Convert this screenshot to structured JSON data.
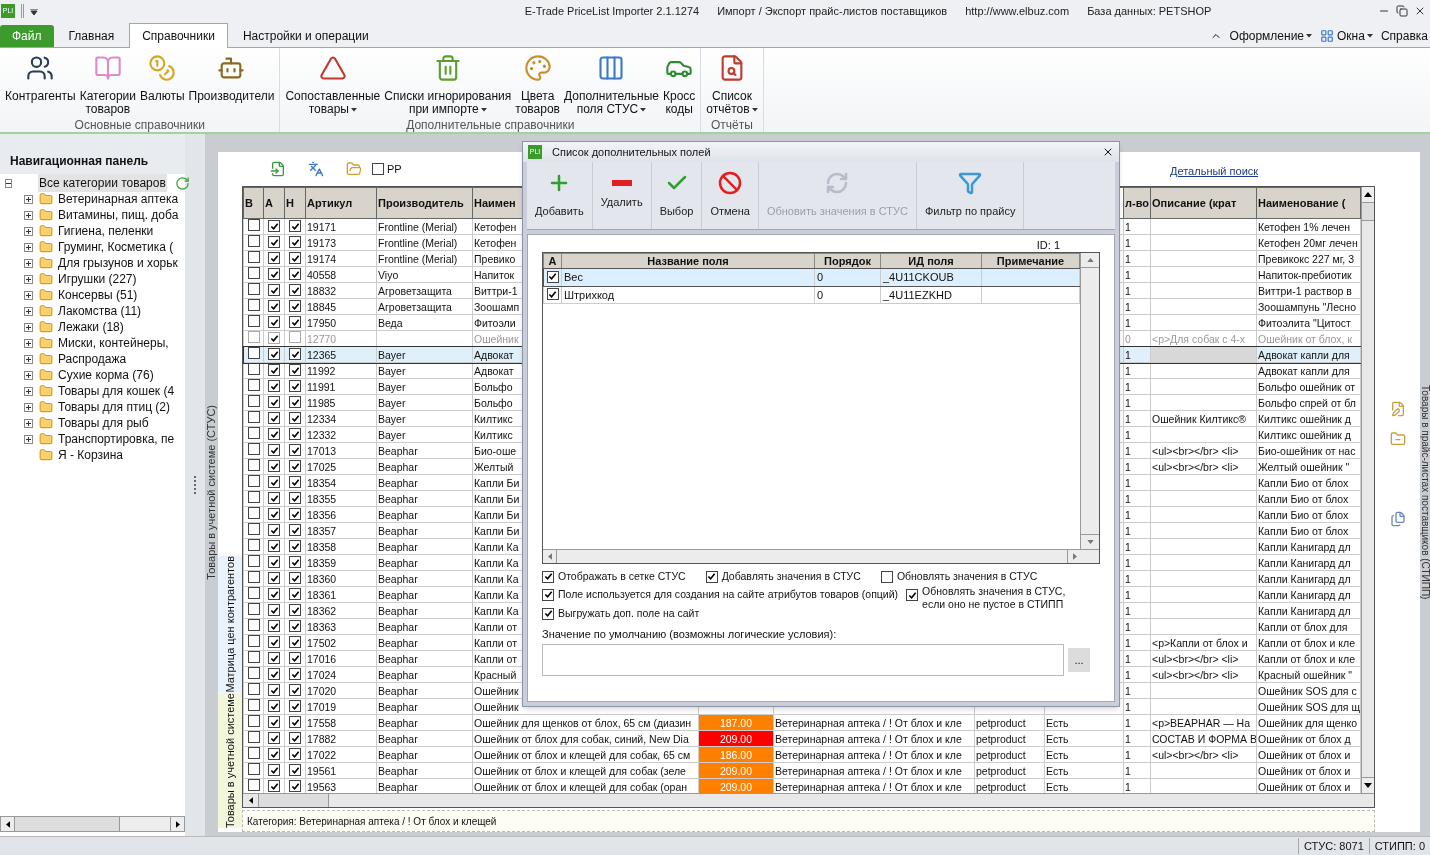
{
  "title_bar": {
    "logo": "PLI",
    "app": "E-Trade PriceList Importer 2.1.1274",
    "subtitle": "Импорт / Экспорт прайс-листов поставщиков",
    "site": "http://www.elbuz.com",
    "database": "База данных: PETSHOP"
  },
  "ribbon_tabs": [
    {
      "label": "Файл",
      "kind": "file",
      "selected": false
    },
    {
      "label": "Главная",
      "kind": "tab",
      "selected": false
    },
    {
      "label": "Справочники",
      "kind": "tab",
      "selected": true
    },
    {
      "label": "Настройки и операции",
      "kind": "tab",
      "selected": false
    }
  ],
  "ribbon_right": [
    {
      "label": "Оформление",
      "dropdown": true
    },
    {
      "label": "Окна",
      "dropdown": true
    },
    {
      "label": "Справка",
      "dropdown": false
    }
  ],
  "ribbon_groups": [
    {
      "title": "Основные справочники",
      "buttons": [
        {
          "label": "Контрагенты",
          "dropdown": false
        },
        {
          "label": "Категории\nтоваров",
          "dropdown": false
        },
        {
          "label": "Валюты",
          "dropdown": false
        },
        {
          "label": "Производители",
          "dropdown": false
        }
      ]
    },
    {
      "title": "Дополнительные справочники",
      "buttons": [
        {
          "label": "Сопоставленные\nтовары",
          "dropdown": true
        },
        {
          "label": "Списки игнорирования\nпри импорте",
          "dropdown": true
        },
        {
          "label": "Цвета\nтоваров",
          "dropdown": false
        },
        {
          "label": "Дополнительные\nполя СТУС",
          "dropdown": true
        },
        {
          "label": "Кросс\nкоды",
          "dropdown": false
        }
      ]
    },
    {
      "title": "Отчёты",
      "buttons": [
        {
          "label": "Список\nотчётов",
          "dropdown": true
        }
      ]
    }
  ],
  "nav_panel": {
    "title": "Навигационная панель",
    "tree": {
      "label": "Все категории товаров",
      "expanded": true,
      "selected": true,
      "children": [
        {
          "label": "Ветеринарная аптека",
          "expandable": true,
          "selected": false
        },
        {
          "label": "Витамины, пищ. доба",
          "expandable": true,
          "selected": false
        },
        {
          "label": "Гигиена, пеленки",
          "expandable": true,
          "selected": false
        },
        {
          "label": "Груминг, Косметика (",
          "expandable": true,
          "selected": false
        },
        {
          "label": "Для грызунов и хорьк",
          "expandable": true,
          "selected": false
        },
        {
          "label": "Игрушки (227)",
          "expandable": true,
          "selected": false
        },
        {
          "label": "Консервы (51)",
          "expandable": true,
          "selected": false
        },
        {
          "label": "Лакомства (11)",
          "expandable": true,
          "selected": false
        },
        {
          "label": "Лежаки (18)",
          "expandable": true,
          "selected": false
        },
        {
          "label": "Миски, контейнеры,",
          "expandable": true,
          "selected": false
        },
        {
          "label": "Распродажа",
          "expandable": true,
          "selected": false
        },
        {
          "label": "Сухие корма (76)",
          "expandable": true,
          "selected": false
        },
        {
          "label": "Товары для кошек (4",
          "expandable": true,
          "selected": false
        },
        {
          "label": "Товары для птиц (2)",
          "expandable": true,
          "selected": false
        },
        {
          "label": "Товары для рыб",
          "expandable": true,
          "selected": false
        },
        {
          "label": "Транспортировка, пе",
          "expandable": true,
          "selected": false
        },
        {
          "label": "Я - Корзина",
          "expandable": false,
          "selected": false
        }
      ]
    }
  },
  "side_tabs": [
    {
      "label": "Товары в учетной системе (СТУС)",
      "selected": false
    },
    {
      "label": "Матрица цен контрагентов",
      "selected": false
    },
    {
      "label": "Товары в учетной системе",
      "selected": true
    }
  ],
  "right_side_tab": "Товары в прайс-листах поставщиков (СТИПП)",
  "grid_toolbar": {
    "checkbox": {
      "label": "PP",
      "checked": false
    },
    "detail_search": "Детальный поиск"
  },
  "grid": {
    "columns": [
      "В",
      "А",
      "Н",
      "Артикул",
      "Производитель",
      "Наимен",
      "",
      "",
      "",
      "",
      "л-во",
      "Описание (крат",
      "Наименование ("
    ],
    "rows": [
      {
        "b": false,
        "a": true,
        "h": true,
        "dimmed": false,
        "selected": false,
        "article": "19171",
        "maker": "Frontline (Merial)",
        "name": "Кетофен",
        "qty": "1",
        "desc": "",
        "name2": "Кетофен 1% лечен"
      },
      {
        "b": false,
        "a": true,
        "h": true,
        "dimmed": false,
        "selected": false,
        "article": "19173",
        "maker": "Frontline (Merial)",
        "name": "Кетофен",
        "qty": "1",
        "desc": "",
        "name2": "Кетофен 20мг лечен"
      },
      {
        "b": false,
        "a": true,
        "h": true,
        "dimmed": false,
        "selected": false,
        "article": "19174",
        "maker": "Frontline (Merial)",
        "name": "Превико",
        "qty": "1",
        "desc": "",
        "name2": "Превикокс 227 мг, 3"
      },
      {
        "b": false,
        "a": true,
        "h": true,
        "dimmed": false,
        "selected": false,
        "article": "40558",
        "maker": "Viyo",
        "name": "Напиток",
        "qty": "1",
        "desc": "",
        "name2": "Напиток-пребиотик"
      },
      {
        "b": false,
        "a": true,
        "h": true,
        "dimmed": false,
        "selected": false,
        "article": "18832",
        "maker": "Агроветзащита",
        "name": "Виттри-1",
        "qty": "1",
        "desc": "",
        "name2": "Виттри-1 раствор в"
      },
      {
        "b": false,
        "a": true,
        "h": true,
        "dimmed": false,
        "selected": false,
        "article": "18845",
        "maker": "Агроветзащита",
        "name": "Зоошамп",
        "qty": "1",
        "desc": "",
        "name2": "Зоошампунь \"Лесно"
      },
      {
        "b": false,
        "a": true,
        "h": true,
        "dimmed": false,
        "selected": false,
        "article": "17950",
        "maker": "Веда",
        "name": "Фитоэли",
        "qty": "1",
        "desc": "",
        "name2": "Фитоэлита \"Цитост"
      },
      {
        "b": false,
        "a": true,
        "h": false,
        "dimmed": true,
        "selected": false,
        "article": "12770",
        "maker": "",
        "name": "Ошейник",
        "qty": "0",
        "desc": "<p>Для собак с 4-х",
        "name2": "Ошейник от блох, к"
      },
      {
        "b": false,
        "a": true,
        "h": true,
        "dimmed": false,
        "selected": true,
        "article": "12365",
        "maker": "Bayer",
        "name": "Адвокат",
        "qty": "1",
        "desc": "",
        "name2": "Адвокат капли для"
      },
      {
        "b": false,
        "a": true,
        "h": true,
        "dimmed": false,
        "selected": false,
        "article": "11992",
        "maker": "Bayer",
        "name": "Адвокат",
        "qty": "1",
        "desc": "",
        "name2": "Адвокат капли для"
      },
      {
        "b": false,
        "a": true,
        "h": true,
        "dimmed": false,
        "selected": false,
        "article": "11991",
        "maker": "Bayer",
        "name": "Больфо",
        "qty": "1",
        "desc": "",
        "name2": "Больфо ошейник от"
      },
      {
        "b": false,
        "a": true,
        "h": true,
        "dimmed": false,
        "selected": false,
        "article": "11985",
        "maker": "Bayer",
        "name": "Больфо",
        "qty": "1",
        "desc": "",
        "name2": "Больфо спрей от бл"
      },
      {
        "b": false,
        "a": true,
        "h": true,
        "dimmed": false,
        "selected": false,
        "article": "12334",
        "maker": "Bayer",
        "name": "Килтикс",
        "qty": "1",
        "desc": "Ошейник Килтикс®",
        "name2": "Килтикс ошейник д"
      },
      {
        "b": false,
        "a": true,
        "h": true,
        "dimmed": false,
        "selected": false,
        "article": "12332",
        "maker": "Bayer",
        "name": "Килтикс",
        "qty": "1",
        "desc": "",
        "name2": "Килтикс ошейник д"
      },
      {
        "b": false,
        "a": true,
        "h": true,
        "dimmed": false,
        "selected": false,
        "article": "17013",
        "maker": "Beaphar",
        "name": "Био-оше",
        "qty": "1",
        "desc": "<ul><br></br> <li>",
        "name2": "Био-ошейник от нас"
      },
      {
        "b": false,
        "a": true,
        "h": true,
        "dimmed": false,
        "selected": false,
        "article": "17025",
        "maker": "Beaphar",
        "name": "Желтый",
        "qty": "1",
        "desc": "<ul><br></br> <li>",
        "name2": "Желтый ошейник \""
      },
      {
        "b": false,
        "a": true,
        "h": true,
        "dimmed": false,
        "selected": false,
        "article": "18354",
        "maker": "Beaphar",
        "name": "Капли Би",
        "qty": "1",
        "desc": "",
        "name2": "Капли Био от блох"
      },
      {
        "b": false,
        "a": true,
        "h": true,
        "dimmed": false,
        "selected": false,
        "article": "18355",
        "maker": "Beaphar",
        "name": "Капли Би",
        "qty": "1",
        "desc": "",
        "name2": "Капли Био от блох"
      },
      {
        "b": false,
        "a": true,
        "h": true,
        "dimmed": false,
        "selected": false,
        "article": "18356",
        "maker": "Beaphar",
        "name": "Капли Би",
        "qty": "1",
        "desc": "",
        "name2": "Капли Био от блох"
      },
      {
        "b": false,
        "a": true,
        "h": true,
        "dimmed": false,
        "selected": false,
        "article": "18357",
        "maker": "Beaphar",
        "name": "Капли Би",
        "qty": "1",
        "desc": "",
        "name2": "Капли Био от блох"
      },
      {
        "b": false,
        "a": true,
        "h": true,
        "dimmed": false,
        "selected": false,
        "article": "18358",
        "maker": "Beaphar",
        "name": "Капли Ка",
        "qty": "1",
        "desc": "",
        "name2": "Капли Канигард дл"
      },
      {
        "b": false,
        "a": true,
        "h": true,
        "dimmed": false,
        "selected": false,
        "article": "18359",
        "maker": "Beaphar",
        "name": "Капли Ка",
        "qty": "1",
        "desc": "",
        "name2": "Капли Канигард дл"
      },
      {
        "b": false,
        "a": true,
        "h": true,
        "dimmed": false,
        "selected": false,
        "article": "18360",
        "maker": "Beaphar",
        "name": "Капли Ка",
        "qty": "1",
        "desc": "",
        "name2": "Капли Канигард дл"
      },
      {
        "b": false,
        "a": true,
        "h": true,
        "dimmed": false,
        "selected": false,
        "article": "18361",
        "maker": "Beaphar",
        "name": "Капли Ка",
        "qty": "1",
        "desc": "",
        "name2": "Капли Канигард дл"
      },
      {
        "b": false,
        "a": true,
        "h": true,
        "dimmed": false,
        "selected": false,
        "article": "18362",
        "maker": "Beaphar",
        "name": "Капли Ка",
        "qty": "1",
        "desc": "",
        "name2": "Капли Канигард дл"
      },
      {
        "b": false,
        "a": true,
        "h": true,
        "dimmed": false,
        "selected": false,
        "article": "18363",
        "maker": "Beaphar",
        "name": "Капли от",
        "qty": "1",
        "desc": "",
        "name2": "Капли от блох для"
      },
      {
        "b": false,
        "a": true,
        "h": true,
        "dimmed": false,
        "selected": false,
        "article": "17502",
        "maker": "Beaphar",
        "name": "Капли от",
        "qty": "1",
        "desc": "<p>Капли от блох и",
        "name2": "Капли от блох и кле"
      },
      {
        "b": false,
        "a": true,
        "h": true,
        "dimmed": false,
        "selected": false,
        "article": "17016",
        "maker": "Beaphar",
        "name": "Капли от",
        "qty": "1",
        "desc": "<ul><br></br> <li>",
        "name2": "Капли от блох и кле"
      },
      {
        "b": false,
        "a": true,
        "h": true,
        "dimmed": false,
        "selected": false,
        "article": "17024",
        "maker": "Beaphar",
        "name": "Красный",
        "qty": "1",
        "desc": "<ul><br></br> <li>",
        "name2": "Красный ошейник \""
      },
      {
        "b": false,
        "a": true,
        "h": true,
        "dimmed": false,
        "selected": false,
        "article": "17020",
        "maker": "Beaphar",
        "name": "Ошейник",
        "qty": "1",
        "desc": "",
        "name2": "Ошейник SOS для с"
      },
      {
        "b": false,
        "a": true,
        "h": true,
        "dimmed": false,
        "selected": false,
        "article": "17019",
        "maker": "Beaphar",
        "name": "Ошейник",
        "qty": "1",
        "desc": "",
        "name2": "Ошейник SOS для щ"
      },
      {
        "b": false,
        "a": true,
        "h": true,
        "dimmed": false,
        "selected": false,
        "article": "17558",
        "maker": "Beaphar",
        "name": "Ошейник для щенков от блох, 65 см (диазин",
        "price": {
          "text": "187.00",
          "color": "#ff8000"
        },
        "category": "Ветеринарная аптека / ! От блох и кле",
        "site": "petproduct",
        "stock": "Есть",
        "qty": "1",
        "desc": "<p>BEAPHAR — На",
        "name2": "Ошейник для щенко"
      },
      {
        "b": false,
        "a": true,
        "h": true,
        "dimmed": false,
        "selected": false,
        "article": "17882",
        "maker": "Beaphar",
        "name": "Ошейник от блох для собак, синий, New Dia",
        "price": {
          "text": "209.00",
          "color": "#ff0000"
        },
        "category": "Ветеринарная аптека / ! От блох и кле",
        "site": "petproduct",
        "stock": "Есть",
        "qty": "1",
        "desc": "СОСТАВ И ФОРМА В",
        "name2": "Ошейник от блох д"
      },
      {
        "b": false,
        "a": true,
        "h": true,
        "dimmed": false,
        "selected": false,
        "article": "17022",
        "maker": "Beaphar",
        "name": "Ошейник от блох и клещей для собак, 65 см",
        "price": {
          "text": "186.00",
          "color": "#ff8000"
        },
        "category": "Ветеринарная аптека / ! От блох и кле",
        "site": "petproduct",
        "stock": "Есть",
        "qty": "1",
        "desc": "<ul><br></br> <li>",
        "name2": "Ошейник от блох и"
      },
      {
        "b": false,
        "a": true,
        "h": true,
        "dimmed": false,
        "selected": false,
        "article": "19561",
        "maker": "Beaphar",
        "name": "Ошейник от блох и клещей для собак (зеле",
        "price": {
          "text": "209.00",
          "color": "#ff8000"
        },
        "category": "Ветеринарная аптека / ! От блох и кле",
        "site": "petproduct",
        "stock": "Есть",
        "qty": "1",
        "desc": "",
        "name2": "Ошейник от блох и"
      },
      {
        "b": false,
        "a": true,
        "h": true,
        "dimmed": false,
        "selected": false,
        "article": "19563",
        "maker": "Beaphar",
        "name": "Ошейник от блох и клещей для собак (оран",
        "price": {
          "text": "209.00",
          "color": "#ff8000"
        },
        "category": "Ветеринарная аптека / ! От блох и кле",
        "site": "petproduct",
        "stock": "Есть",
        "qty": "1",
        "desc": "",
        "name2": "Ошейник от блох и"
      }
    ]
  },
  "category_bar": "Категория: Ветеринарная аптека / ! От блох и клещей",
  "dialog": {
    "logo": "PLI",
    "title": "Список дополнительных полей",
    "toolbar": [
      {
        "label": "Добавить",
        "disabled": false
      },
      {
        "label": "Удалить",
        "disabled": false
      },
      {
        "label": "Выбор",
        "disabled": false
      },
      {
        "label": "Отмена",
        "disabled": false
      },
      {
        "label": "Обновить значения в СТУС",
        "disabled": true
      },
      {
        "label": "Фильтр по прайсу",
        "disabled": false
      }
    ],
    "id_label": "ID: 1",
    "columns": [
      "А",
      "Название поля",
      "Порядок",
      "ИД поля",
      "Примечание"
    ],
    "rows": [
      {
        "checked": true,
        "selected": true,
        "name": "Вес",
        "order": "0",
        "field_id": "_4U11CKOUB"
      },
      {
        "checked": true,
        "selected": false,
        "name": "Штрихкод",
        "order": "0",
        "field_id": "_4U11EZKHD"
      }
    ],
    "options": [
      {
        "label": "Отображать в сетке СТУС",
        "checked": true
      },
      {
        "label": "Добавлять значения в СТУС",
        "checked": true
      },
      {
        "label": "Обновлять значения в СТУС",
        "checked": false
      },
      {
        "label": "Поле используется для создания на сайте атрибутов товаров (опций)",
        "checked": true
      },
      {
        "label": "Обновлять значения в СТУС,\nесли оно не пустое в СТИПП",
        "checked": true
      },
      {
        "label": "Выгружать доп. поле на сайт",
        "checked": true
      }
    ],
    "default_label": "Значение по умолчанию (возможны логические условия):",
    "more_button": "..."
  },
  "status_bar": [
    "СТУС: 8071",
    "СТИПП: 0"
  ]
}
